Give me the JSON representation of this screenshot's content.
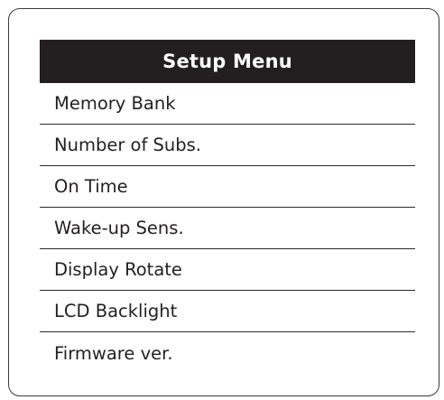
{
  "menu": {
    "title": "Setup Menu",
    "items": [
      {
        "label": "Memory Bank"
      },
      {
        "label": "Number of Subs."
      },
      {
        "label": "On Time"
      },
      {
        "label": "Wake-up Sens."
      },
      {
        "label": "Display Rotate"
      },
      {
        "label": "LCD Backlight"
      },
      {
        "label": "Firmware ver."
      }
    ]
  },
  "colors": {
    "header_background": "#231f20",
    "header_text": "#ffffff",
    "item_text": "#231f20",
    "frame_border": "#3a3a3a"
  }
}
